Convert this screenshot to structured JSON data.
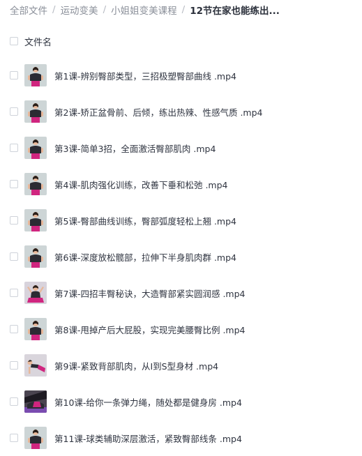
{
  "breadcrumb": [
    {
      "label": "全部文件",
      "current": false
    },
    {
      "label": "运动变美",
      "current": false
    },
    {
      "label": "小姐姐变美课程",
      "current": false
    },
    {
      "label": "12节在家也能练出...",
      "current": true
    }
  ],
  "breadcrumb_separator": "/",
  "list_header": {
    "label": "文件名"
  },
  "files": [
    {
      "name": "第1课-辨别臀部类型，三招极塑臀部曲线 .mp4",
      "thumb": "standing-coach-icon",
      "bg": "#cdd5d6"
    },
    {
      "name": "第2课-矫正盆骨前、后倾，练出热辣、性感气质 .mp4",
      "thumb": "standing-coach-icon",
      "bg": "#cdd5d6"
    },
    {
      "name": "第3课-简单3招，全面激活臀部肌肉 .mp4",
      "thumb": "standing-coach-icon",
      "bg": "#cdd5d6"
    },
    {
      "name": "第4课-肌肉强化训练，改善下垂和松弛 .mp4",
      "thumb": "standing-coach-icon",
      "bg": "#cdd5d6"
    },
    {
      "name": "第5课-臀部曲线训练，臀部弧度轻松上翘 .mp4",
      "thumb": "standing-coach-icon",
      "bg": "#cdd5d6"
    },
    {
      "name": "第6课-深度放松髋部，拉伸下半身肌肉群 .mp4",
      "thumb": "standing-coach-icon",
      "bg": "#cdd5d6"
    },
    {
      "name": "第7课-四招丰臀秘诀，大造臀部紧实圆润感 .mp4",
      "thumb": "sitting-stretch-icon",
      "bg": "#d8d3dc"
    },
    {
      "name": "第8课-甩掉产后大屁股，实现完美腰臀比例 .mp4",
      "thumb": "standing-coach-icon",
      "bg": "#cdd5d6"
    },
    {
      "name": "第9课-紧致背部肌肉，从I到S型身材 .mp4",
      "thumb": "floor-exercise-icon",
      "bg": "#d9d5dc"
    },
    {
      "name": "第10课-给你一条弹力绳，随处都是健身房 .mp4",
      "thumb": "resistance-band-icon",
      "bg": "#4a4450"
    },
    {
      "name": "第11课-球类辅助深层激活，紧致臀部线条 .mp4",
      "thumb": "standing-coach-icon",
      "bg": "#cdd5d6"
    }
  ],
  "colors": {
    "shirt": "#2b2b33",
    "pants": "#d0257f",
    "skin": "#e8b89a",
    "hair": "#2a1f1a"
  }
}
